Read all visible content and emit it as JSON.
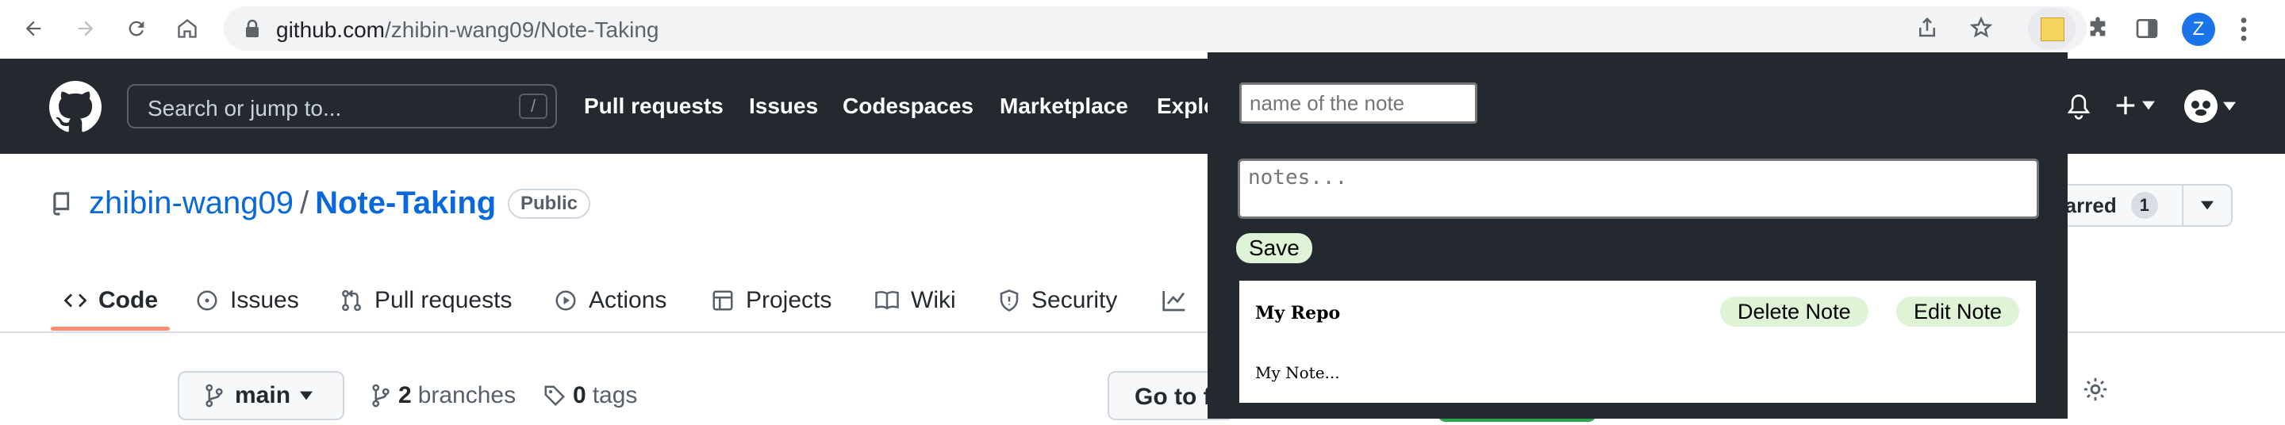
{
  "browser": {
    "url_host": "github.com",
    "url_path": "/zhibin-wang09/Note-Taking",
    "profile_initial": "Z",
    "icons": [
      "back-icon",
      "forward-icon",
      "reload-icon",
      "home-icon",
      "lock-icon",
      "share-icon",
      "star-icon",
      "extension-note-icon",
      "puzzle-icon",
      "side-panel-icon",
      "kebab-menu-icon"
    ]
  },
  "github": {
    "search_placeholder": "Search or jump to...",
    "search_shortcut": "/",
    "nav": [
      "Pull requests",
      "Issues",
      "Codespaces",
      "Marketplace",
      "Explo"
    ],
    "repo_owner": "zhibin-wang09",
    "repo_separator": "/",
    "repo_name": "Note-Taking",
    "visibility": "Public",
    "starred_label": "tarred",
    "starred_count": "1",
    "tabs": [
      "Code",
      "Issues",
      "Pull requests",
      "Actions",
      "Projects",
      "Wiki",
      "Security"
    ],
    "branch": "main",
    "branches_count": "2",
    "branches_label": "branches",
    "tags_count": "0",
    "tags_label": "tags",
    "goto_label": "Go to fi"
  },
  "popup": {
    "name_placeholder": "name of the note",
    "notes_placeholder": "notes...",
    "save_label": "Save",
    "note": {
      "title": "My Repo",
      "body": "My Note...",
      "delete_label": "Delete Note",
      "edit_label": "Edit Note"
    }
  },
  "colors": {
    "header_bg": "#24292f",
    "link_blue": "#0969da",
    "tab_underline": "#fd8c73",
    "pill_green": "#dff3d7",
    "profile_blue": "#1a73e8"
  }
}
